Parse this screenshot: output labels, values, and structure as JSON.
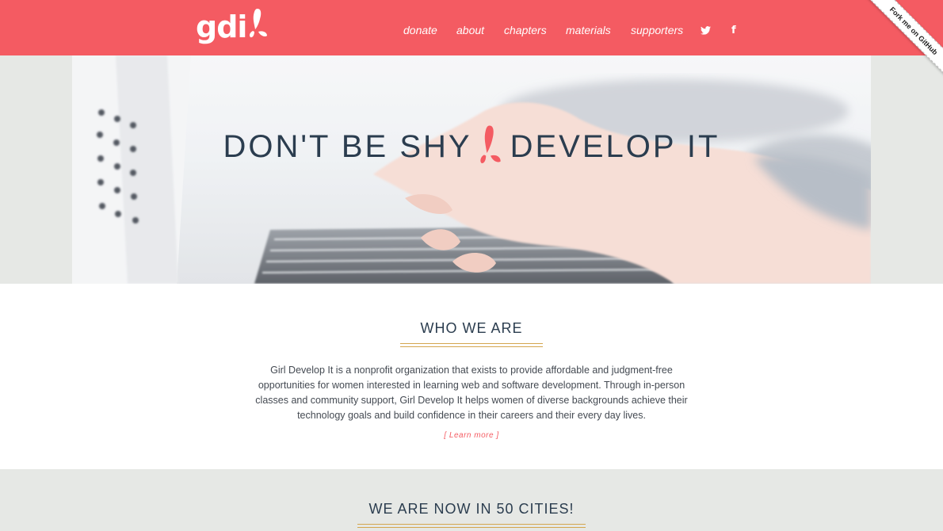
{
  "header": {
    "logo_text": "gdi",
    "nav": [
      {
        "label": "donate"
      },
      {
        "label": "about"
      },
      {
        "label": "chapters"
      },
      {
        "label": "materials"
      },
      {
        "label": "supporters"
      }
    ],
    "social": [
      {
        "icon": "twitter-icon",
        "glyph": "🐦︎"
      },
      {
        "icon": "facebook-icon",
        "glyph": "f"
      }
    ],
    "ribbon_label": "Fork me on GitHub"
  },
  "hero": {
    "title_left": "DON'T BE SHY",
    "title_right": "DEVELOP IT"
  },
  "who": {
    "heading": "WHO WE ARE",
    "body": "Girl Develop It is a nonprofit organization that exists to provide affordable and judgment-free opportunities for women interested in learning web and software development. Through in-person classes and community support, Girl Develop It helps women of diverse backgrounds achieve their technology goals and build confidence in their careers and their every day lives.",
    "learn_more": "[ Learn more ]"
  },
  "cities": {
    "heading": "WE ARE NOW IN 50 CITIES!"
  },
  "colors": {
    "brand": "#f45b62",
    "heading": "#2b3d4f",
    "accent_rule": "#d4a64f",
    "band": "#e6e8e5"
  }
}
